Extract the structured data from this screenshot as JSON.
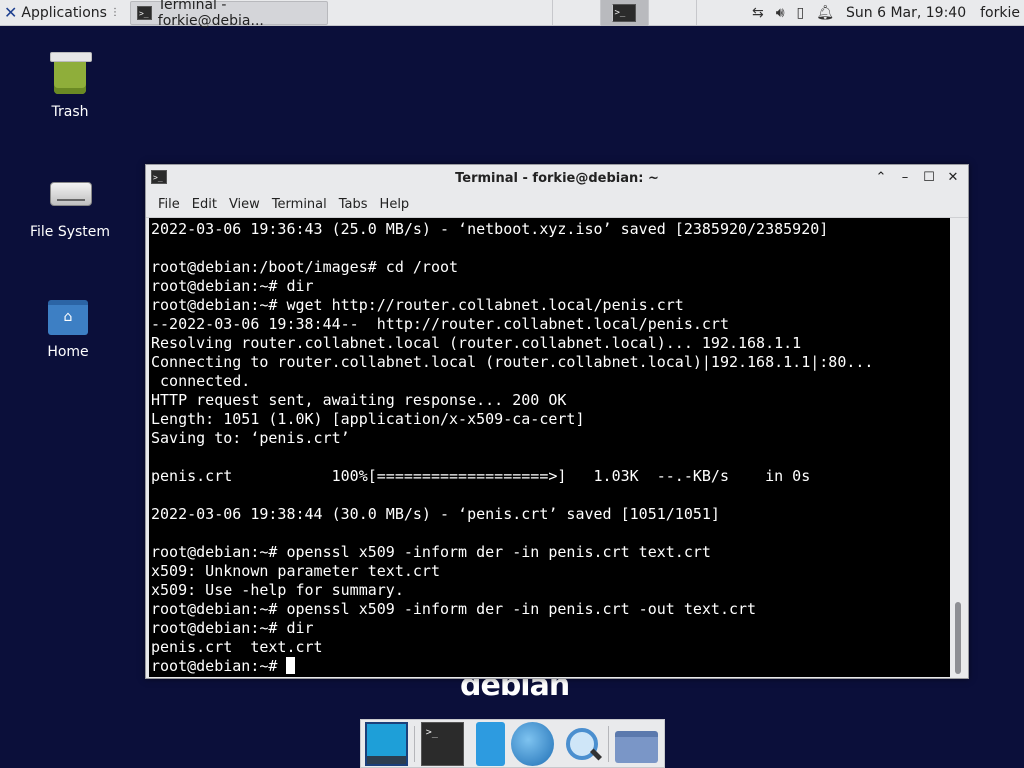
{
  "panel": {
    "apps_label": "Applications",
    "task_title": "Terminal - forkie@debia...",
    "clock": "Sun  6 Mar, 19:40",
    "user": "forkie"
  },
  "desktop": {
    "icons": [
      {
        "label": "Trash"
      },
      {
        "label": "File System"
      },
      {
        "label": "Home"
      }
    ],
    "wallpaper_text": "debian"
  },
  "window": {
    "title": "Terminal - forkie@debian: ~",
    "menu": [
      "File",
      "Edit",
      "View",
      "Terminal",
      "Tabs",
      "Help"
    ],
    "terminal_lines": [
      "2022-03-06 19:36:43 (25.0 MB/s) - ‘netboot.xyz.iso’ saved [2385920/2385920]",
      "",
      "root@debian:/boot/images# cd /root",
      "root@debian:~# dir",
      "root@debian:~# wget http://router.collabnet.local/penis.crt",
      "--2022-03-06 19:38:44--  http://router.collabnet.local/penis.crt",
      "Resolving router.collabnet.local (router.collabnet.local)... 192.168.1.1",
      "Connecting to router.collabnet.local (router.collabnet.local)|192.168.1.1|:80...",
      " connected.",
      "HTTP request sent, awaiting response... 200 OK",
      "Length: 1051 (1.0K) [application/x-x509-ca-cert]",
      "Saving to: ‘penis.crt’",
      "",
      "penis.crt           100%[===================>]   1.03K  --.-KB/s    in 0s",
      "",
      "2022-03-06 19:38:44 (30.0 MB/s) - ‘penis.crt’ saved [1051/1051]",
      "",
      "root@debian:~# openssl x509 -inform der -in penis.crt text.crt",
      "x509: Unknown parameter text.crt",
      "x509: Use -help for summary.",
      "root@debian:~# openssl x509 -inform der -in penis.crt -out text.crt",
      "root@debian:~# dir",
      "penis.crt  text.crt"
    ],
    "prompt": "root@debian:~# "
  },
  "dock": {
    "items": [
      "show-desktop",
      "terminal",
      "file-manager-launcher",
      "web-browser",
      "app-finder",
      "folder"
    ]
  }
}
